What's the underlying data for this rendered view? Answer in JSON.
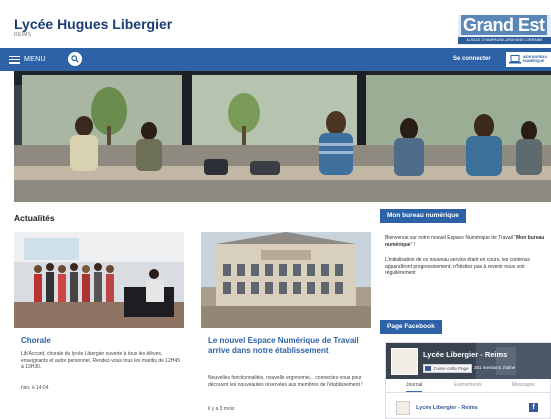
{
  "header": {
    "title": "Lycée Hugues Libergier",
    "subtitle": "REIMS",
    "brand_name": "Grand Est",
    "brand_tagline": "ALSACE CHAMPAGNE-ARDENNE LORRAINE"
  },
  "nav": {
    "menu_label": "MENU",
    "search_icon": "search-icon",
    "connect_label": "Se connecter",
    "bureau_button_label": "MON BUREAU NUMÉRIQUE"
  },
  "news": {
    "section_title": "Actualités",
    "items": [
      {
        "title": "Chorale",
        "text": "Lib'Accord, chorale du lycée Libergier ouverte à tous les élèves, enseignants et autre personnel. Rendez-vous tous les mardis de 12H45 à 13H30.",
        "date": "hier, à 14:04"
      },
      {
        "title": "Le nouvel Espace Numérique de Travail arrive dans notre établissement",
        "text": "Nouvelles fonctionnalités, nouvelle ergonomie... connectez-vous pour découvrir les nouveautés réservées aux membres de l'établissement !",
        "date": "il y a 3 mois"
      }
    ]
  },
  "sidebar": {
    "bureau_title": "Mon bureau numérique",
    "bureau_welcome_prefix": "Bienvenue sur notre nouvel Espace Numérique de Travail \"",
    "bureau_welcome_strong": "Mon bureau numérique",
    "bureau_welcome_suffix": "\" !",
    "bureau_text": "L'initialisation de ce nouveau service étant en cours, les contenus apparaîtront progressivement, n'hésitez pas à revenir nous voir régulièrement",
    "facebook_title": "Page Facebook",
    "facebook": {
      "page_name": "Lycée Libergier - Reims",
      "like_label": "J'aime cette Page",
      "likes_count": "251 mentions J'aime",
      "tabs": [
        "Journal",
        "Événements",
        "Messages"
      ],
      "post_author": "Lycée Libergier - Reims"
    }
  },
  "colors": {
    "primary": "#2e62a6",
    "title": "#1b3d75",
    "facebook": "#3b5998"
  }
}
